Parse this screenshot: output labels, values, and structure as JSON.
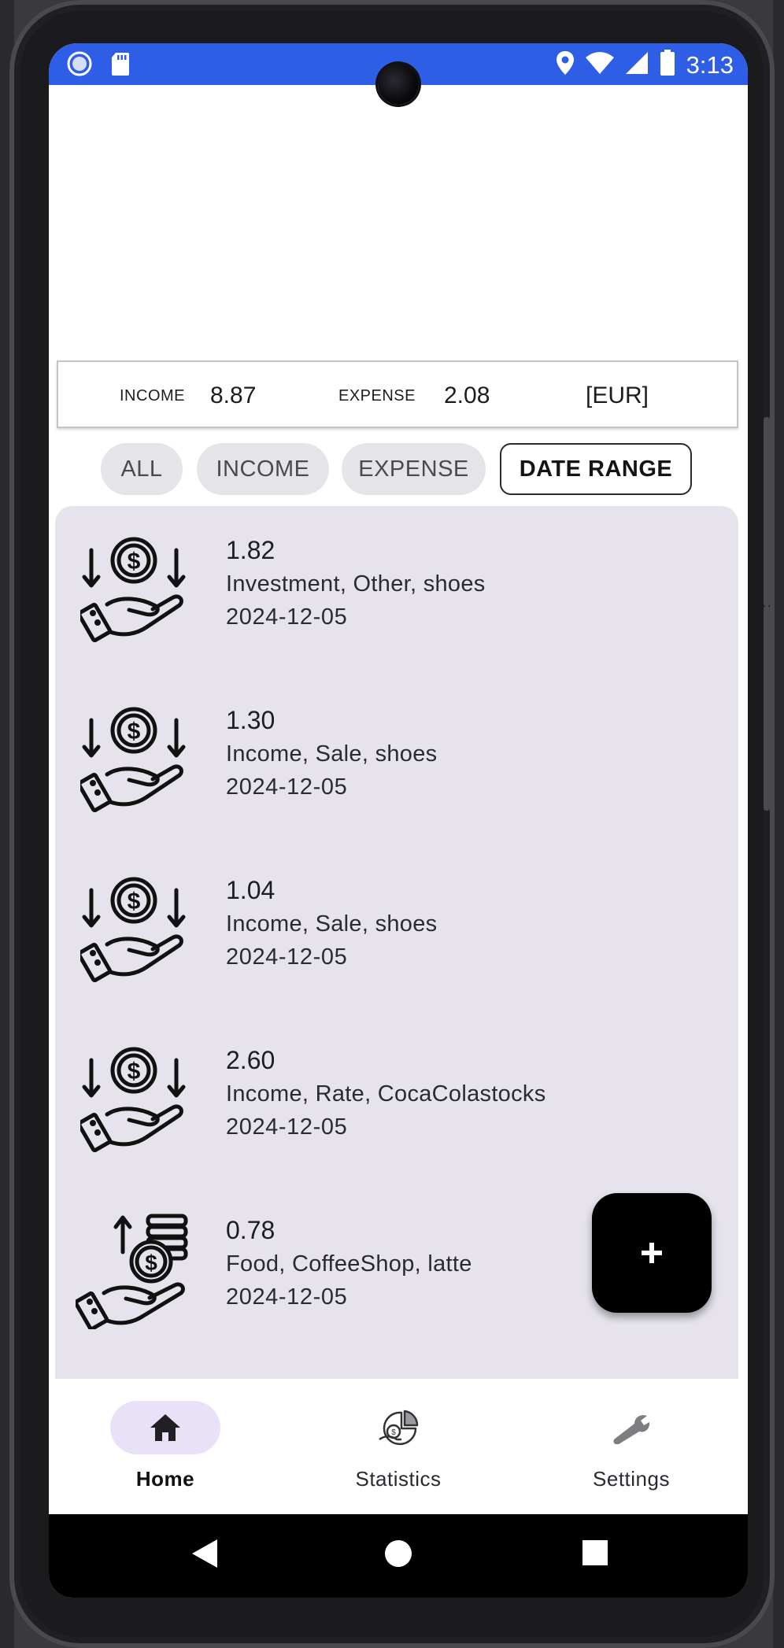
{
  "status_bar": {
    "time": "3:13",
    "icons_left": [
      "circle-notification-icon",
      "sd-card-icon"
    ],
    "icons_right": [
      "location-icon",
      "wifi-icon",
      "signal-icon",
      "battery-icon"
    ]
  },
  "summary": {
    "income_label": "INCOME",
    "income_value": "8.87",
    "expense_label": "EXPENSE",
    "expense_value": "2.08",
    "currency": "[EUR]"
  },
  "filters": [
    {
      "label": "ALL",
      "selected": false
    },
    {
      "label": "INCOME",
      "selected": false
    },
    {
      "label": "EXPENSE",
      "selected": false
    },
    {
      "label": "DATE RANGE",
      "selected": true
    }
  ],
  "transactions": [
    {
      "amount": "1.82",
      "categories": "Investment, Other, shoes",
      "date": "2024-12-05",
      "icon": "income-hand-coin-icon"
    },
    {
      "amount": "1.30",
      "categories": "Income, Sale, shoes",
      "date": "2024-12-05",
      "icon": "income-hand-coin-icon"
    },
    {
      "amount": "1.04",
      "categories": "Income, Sale, shoes",
      "date": "2024-12-05",
      "icon": "income-hand-coin-icon"
    },
    {
      "amount": "2.60",
      "categories": "Income, Rate, CocaColastocks",
      "date": "2024-12-05",
      "icon": "income-hand-coin-icon"
    },
    {
      "amount": "0.78",
      "categories": "Food, CoffeeShop, latte",
      "date": "2024-12-05",
      "icon": "expense-hand-coins-icon"
    }
  ],
  "fab": {
    "label": "+"
  },
  "bottom_nav": [
    {
      "label": "Home",
      "icon": "home-icon",
      "active": true
    },
    {
      "label": "Statistics",
      "icon": "statistics-icon",
      "active": false
    },
    {
      "label": "Settings",
      "icon": "wrench-icon",
      "active": false
    }
  ],
  "colors": {
    "status_bar": "#2f5ee6",
    "list_background": "#e6e3ec",
    "chip_background": "#e5e4e8",
    "nav_active_pill": "#e9e1f8",
    "fab": "#000000"
  }
}
